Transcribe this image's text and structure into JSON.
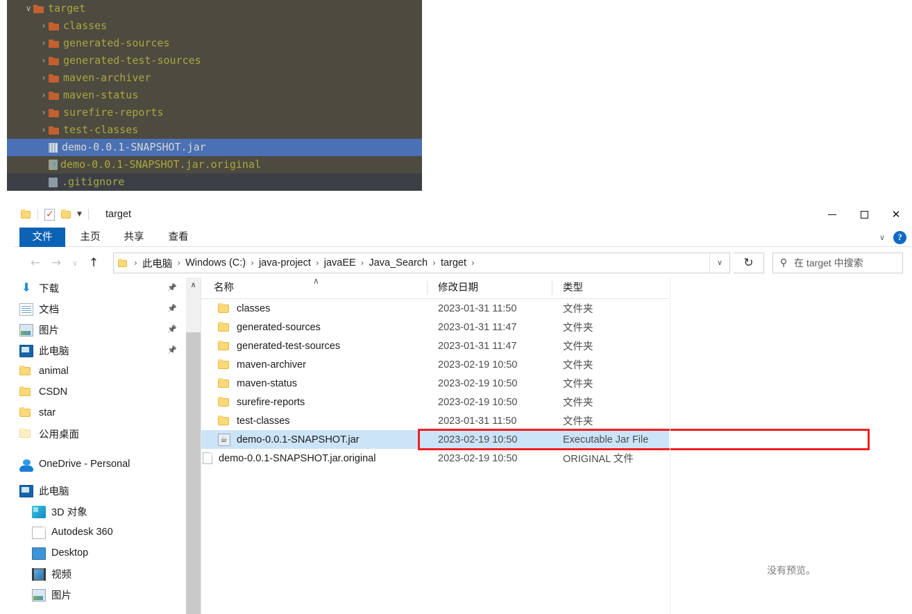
{
  "ide_tree": {
    "rows": [
      {
        "indent": 0,
        "arrow": "∨",
        "icon": "folder-icon",
        "label": "target",
        "state": "normal"
      },
      {
        "indent": 1,
        "arrow": "›",
        "icon": "folder-icon",
        "label": "classes",
        "state": "normal"
      },
      {
        "indent": 1,
        "arrow": "›",
        "icon": "folder-icon",
        "label": "generated-sources",
        "state": "normal"
      },
      {
        "indent": 1,
        "arrow": "›",
        "icon": "folder-icon",
        "label": "generated-test-sources",
        "state": "normal"
      },
      {
        "indent": 1,
        "arrow": "›",
        "icon": "folder-icon",
        "label": "maven-archiver",
        "state": "normal"
      },
      {
        "indent": 1,
        "arrow": "›",
        "icon": "folder-icon",
        "label": "maven-status",
        "state": "normal"
      },
      {
        "indent": 1,
        "arrow": "›",
        "icon": "folder-icon",
        "label": "surefire-reports",
        "state": "normal"
      },
      {
        "indent": 1,
        "arrow": "›",
        "icon": "folder-icon",
        "label": "test-classes",
        "state": "normal"
      },
      {
        "indent": 1,
        "arrow": "",
        "icon": "jar-file-icon",
        "label": "demo-0.0.1-SNAPSHOT.jar",
        "state": "selected"
      },
      {
        "indent": 1,
        "arrow": "",
        "icon": "unknown-file-icon",
        "label": "demo-0.0.1-SNAPSHOT.jar.original",
        "state": "normal"
      },
      {
        "indent": 1,
        "arrow": "",
        "icon": "gitignore-icon",
        "label": ".gitignore",
        "state": "dark"
      }
    ],
    "colors": {
      "background": "#4d4a40",
      "selection": "#4a70b5",
      "text": "#a9a83e",
      "folder": "#c2602f"
    }
  },
  "explorer": {
    "titlebar": {
      "title": "target",
      "quick_access": [
        "folder-icon",
        "properties-icon",
        "new-folder-icon",
        "customize-caret-icon"
      ],
      "window_controls": {
        "minimize": "–",
        "maximize": "□",
        "close": "✕"
      }
    },
    "ribbon": {
      "tabs": [
        {
          "label": "文件",
          "active": true
        },
        {
          "label": "主页",
          "active": false
        },
        {
          "label": "共享",
          "active": false
        },
        {
          "label": "查看",
          "active": false
        }
      ],
      "expand_caret": "∨",
      "help": "?"
    },
    "navigation": {
      "back": "←",
      "forward": "→",
      "recent": "∨",
      "up": "↑",
      "refresh": "↻",
      "address_caret": "∨",
      "breadcrumbs": [
        "此电脑",
        "Windows (C:)",
        "java-project",
        "javaEE",
        "Java_Search",
        "target"
      ],
      "breadcrumb_separator": "›"
    },
    "search": {
      "icon": "search-icon",
      "placeholder": "在 target 中搜索"
    },
    "nav_pane": {
      "items": [
        {
          "label": "下载",
          "icon": "download-icon",
          "pinned": true,
          "indent": 0
        },
        {
          "label": "文档",
          "icon": "documents-icon",
          "pinned": true,
          "indent": 0
        },
        {
          "label": "图片",
          "icon": "pictures-icon",
          "pinned": true,
          "indent": 0
        },
        {
          "label": "此电脑",
          "icon": "this-pc-icon",
          "pinned": true,
          "indent": 0
        },
        {
          "label": "animal",
          "icon": "folder-icon",
          "pinned": false,
          "indent": 0
        },
        {
          "label": "CSDN",
          "icon": "folder-icon",
          "pinned": false,
          "indent": 0
        },
        {
          "label": "star",
          "icon": "folder-icon",
          "pinned": false,
          "indent": 0
        },
        {
          "label": "公用桌面",
          "icon": "folder-pale-icon",
          "pinned": false,
          "indent": 0
        },
        {
          "label": "OneDrive - Personal",
          "icon": "onedrive-icon",
          "pinned": false,
          "indent": 0
        },
        {
          "label": "此电脑",
          "icon": "this-pc-icon",
          "pinned": false,
          "indent": 0
        },
        {
          "label": "3D 对象",
          "icon": "3d-objects-icon",
          "pinned": false,
          "indent": 1
        },
        {
          "label": "Autodesk 360",
          "icon": "file-icon",
          "pinned": false,
          "indent": 1
        },
        {
          "label": "Desktop",
          "icon": "desktop-icon",
          "pinned": false,
          "indent": 1
        },
        {
          "label": "视频",
          "icon": "videos-icon",
          "pinned": false,
          "indent": 1
        },
        {
          "label": "图片",
          "icon": "pictures-icon",
          "pinned": false,
          "indent": 1
        }
      ],
      "scroll_up_arrow": "∧"
    },
    "file_list": {
      "columns": [
        {
          "label": "名称",
          "sorted": true,
          "sort_caret": "∧"
        },
        {
          "label": "修改日期",
          "sorted": false
        },
        {
          "label": "类型",
          "sorted": false
        }
      ],
      "rows": [
        {
          "name": "classes",
          "date": "2023-01-31 11:50",
          "type": "文件夹",
          "icon": "folder-icon",
          "selected": false
        },
        {
          "name": "generated-sources",
          "date": "2023-01-31 11:47",
          "type": "文件夹",
          "icon": "folder-icon",
          "selected": false
        },
        {
          "name": "generated-test-sources",
          "date": "2023-01-31 11:47",
          "type": "文件夹",
          "icon": "folder-icon",
          "selected": false
        },
        {
          "name": "maven-archiver",
          "date": "2023-02-19 10:50",
          "type": "文件夹",
          "icon": "folder-icon",
          "selected": false
        },
        {
          "name": "maven-status",
          "date": "2023-02-19 10:50",
          "type": "文件夹",
          "icon": "folder-icon",
          "selected": false
        },
        {
          "name": "surefire-reports",
          "date": "2023-02-19 10:50",
          "type": "文件夹",
          "icon": "folder-icon",
          "selected": false
        },
        {
          "name": "test-classes",
          "date": "2023-01-31 11:50",
          "type": "文件夹",
          "icon": "folder-icon",
          "selected": false
        },
        {
          "name": "demo-0.0.1-SNAPSHOT.jar",
          "date": "2023-02-19 10:50",
          "type": "Executable Jar File",
          "icon": "jar-file-icon",
          "selected": true
        },
        {
          "name": "demo-0.0.1-SNAPSHOT.jar.original",
          "date": "2023-02-19 10:50",
          "type": "ORIGINAL 文件",
          "icon": "original-file-icon",
          "selected": false
        }
      ],
      "highlight_color": "#f02020",
      "selection_color": "#cce4f7"
    },
    "preview_pane": {
      "message": "没有预览。"
    }
  }
}
